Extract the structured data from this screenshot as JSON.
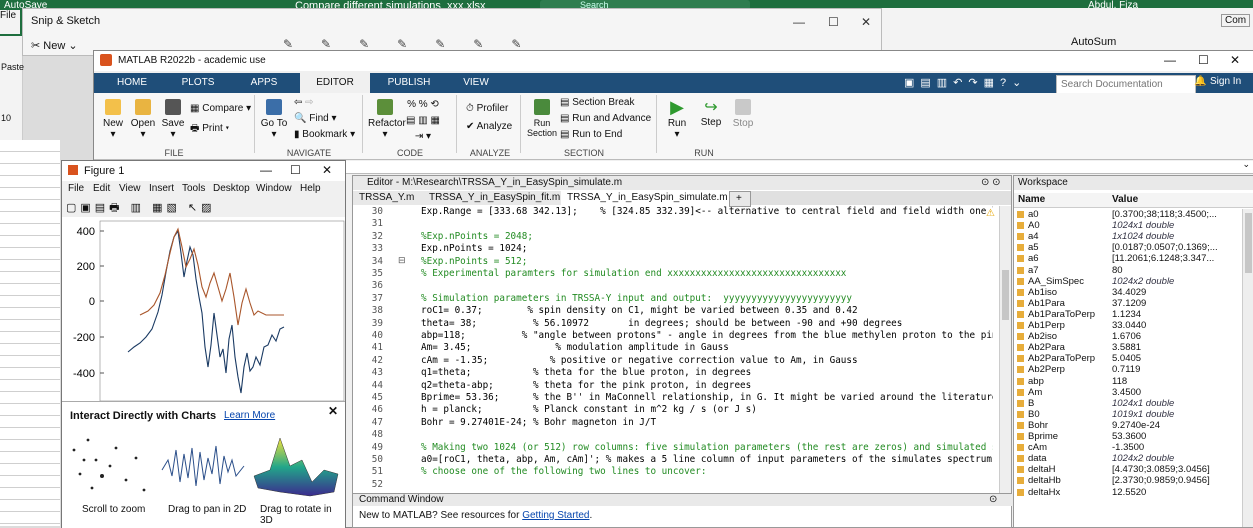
{
  "excel": {
    "title": "Compare different simulations_xxx.xlsx",
    "autosave_label": "AutoSave",
    "file_label": "File",
    "search_label": "Search",
    "user": "Abdul, Fiza",
    "autosum_label": "AutoSum",
    "paste_label": "Paste",
    "cell_ref": "10"
  },
  "snip": {
    "title": "Snip & Sketch",
    "new_label": "New"
  },
  "matlab": {
    "title": "MATLAB R2022b - academic use",
    "tabs": [
      "HOME",
      "PLOTS",
      "APPS",
      "EDITOR",
      "PUBLISH",
      "VIEW"
    ],
    "search_placeholder": "Search Documentation",
    "sign_in": "Sign In",
    "ribbon": {
      "new": "New",
      "open": "Open",
      "save": "Save",
      "compare": "Compare",
      "print": "Print",
      "goto": "Go To",
      "find": "Find",
      "bookmark": "Bookmark",
      "refactor": "Refactor",
      "profiler": "Profiler",
      "analyze": "Analyze",
      "run_section": "Run Section",
      "section_break": "Section Break",
      "run_and_advance": "Run and Advance",
      "run_to_end": "Run to End",
      "run": "Run",
      "step": "Step",
      "stop": "Stop",
      "sections": [
        "FILE",
        "NAVIGATE",
        "CODE",
        "ANALYZE",
        "SECTION",
        "RUN"
      ]
    }
  },
  "figure": {
    "title": "Figure 1",
    "menu": [
      "File",
      "Edit",
      "View",
      "Insert",
      "Tools",
      "Desktop",
      "Window",
      "Help"
    ],
    "y_ticks": [
      "400",
      "200",
      "0",
      "-200",
      "-400"
    ],
    "interact_title": "Interact Directly with Charts",
    "learn_more": "Learn More",
    "captions": [
      "Scroll to zoom",
      "Drag to pan in 2D",
      "Drag to rotate in 3D"
    ]
  },
  "editor": {
    "path": "Editor - M:\\Research\\TRSSA_Y_in_EasySpin_simulate.m",
    "tabs": [
      "TRSSA_Y.m",
      "TRSSA_Y_in_EasySpin_fit.m",
      "TRSSA_Y_in_EasySpin_simulate.m",
      "+"
    ],
    "lines": [
      {
        "n": "30",
        "t": "Exp.Range = [333.68 342.13];    % [324.85 332.39]<-- alternative to central field and field width one line"
      },
      {
        "n": "31",
        "t": ""
      },
      {
        "n": "32",
        "t": "%Exp.nPoints = 2048;"
      },
      {
        "n": "33",
        "t": "Exp.nPoints = 1024;"
      },
      {
        "n": "34",
        "t": "%Exp.nPoints = 512;"
      },
      {
        "n": "35",
        "t": "% Experimental paramters for simulation end xxxxxxxxxxxxxxxxxxxxxxxxxxxxxxxx"
      },
      {
        "n": "36",
        "t": ""
      },
      {
        "n": "37",
        "t": "% Simulation parameters in TRSSA-Y input and output:  yyyyyyyyyyyyyyyyyyyyyyy"
      },
      {
        "n": "38",
        "t": "roC1= 0.37;        % spin density on C1, might be varied between 0.35 and 0.42"
      },
      {
        "n": "39",
        "t": "theta= 38;          % 56.10972       in degrees; should be between -90 and +90 degrees"
      },
      {
        "n": "40",
        "t": "abp=118;          % \"angle between protons\" - angle in degrees from the blue methylen proton to the pink"
      },
      {
        "n": "41",
        "t": "Am= 3.45;               % modulation amplitude in Gauss"
      },
      {
        "n": "42",
        "t": "cAm = -1.35;           % positive or negative correction value to Am, in Gauss"
      },
      {
        "n": "43",
        "t": "q1=theta;           % theta for the blue proton, in degrees"
      },
      {
        "n": "44",
        "t": "q2=theta-abp;       % theta for the pink proton, in degrees"
      },
      {
        "n": "45",
        "t": "Bprime= 53.36;      % the B'' in MaConnell relationship, in G. It might be varied around the literature va"
      },
      {
        "n": "46",
        "t": "h = planck;         % Planck constant in m^2 kg / s (or J s)"
      },
      {
        "n": "47",
        "t": "Bohr = 9.27401E-24; % Bohr magneton in J/T"
      },
      {
        "n": "48",
        "t": ""
      },
      {
        "n": "49",
        "t": "% Making two 1024 (or 512) row columns: five simulation parameters (the rest are zeros) and simulated spec"
      },
      {
        "n": "50",
        "t": "a0=[roC1, theta, abp, Am, cAm]'; % makes a 5 line column of input parameters of the simulates spectrum"
      },
      {
        "n": "51",
        "t": "% choose one of the following two lines to uncover:"
      },
      {
        "n": "52",
        "t": ""
      }
    ]
  },
  "command_window": {
    "title": "Command Window",
    "message": "New to MATLAB? See resources for ",
    "link": "Getting Started",
    "suffix": "."
  },
  "workspace": {
    "title": "Workspace",
    "col_name": "Name",
    "col_value": "Value",
    "rows": [
      {
        "name": "a0",
        "value": "[0.3700;38;118;3.4500;..."
      },
      {
        "name": "A0",
        "value": "1024x1 double",
        "italic": true
      },
      {
        "name": "a4",
        "value": "1x1024 double",
        "italic": true
      },
      {
        "name": "a5",
        "value": "[0.0187;0.0507;0.1369;..."
      },
      {
        "name": "a6",
        "value": "[11.2061;6.1248;3.347..."
      },
      {
        "name": "a7",
        "value": "80"
      },
      {
        "name": "AA_SimSpec",
        "value": "1024x2 double",
        "italic": true
      },
      {
        "name": "Ab1iso",
        "value": "34.4029"
      },
      {
        "name": "Ab1Para",
        "value": "37.1209"
      },
      {
        "name": "Ab1ParaToPerp",
        "value": "1.1234"
      },
      {
        "name": "Ab1Perp",
        "value": "33.0440"
      },
      {
        "name": "Ab2iso",
        "value": "1.6706"
      },
      {
        "name": "Ab2Para",
        "value": "3.5881"
      },
      {
        "name": "Ab2ParaToPerp",
        "value": "5.0405"
      },
      {
        "name": "Ab2Perp",
        "value": "0.7119"
      },
      {
        "name": "abp",
        "value": "118"
      },
      {
        "name": "Am",
        "value": "3.4500"
      },
      {
        "name": "B",
        "value": "1024x1 double",
        "italic": true
      },
      {
        "name": "B0",
        "value": "1019x1 double",
        "italic": true
      },
      {
        "name": "Bohr",
        "value": "9.2740e-24"
      },
      {
        "name": "Bprime",
        "value": "53.3600"
      },
      {
        "name": "cAm",
        "value": "-1.3500"
      },
      {
        "name": "data",
        "value": "1024x2 double",
        "italic": true
      },
      {
        "name": "deltaH",
        "value": "[4.4730;3.0859;3.0456]"
      },
      {
        "name": "deltaHb",
        "value": "[2.3730;0.9859;0.9456]"
      },
      {
        "name": "deltaHx",
        "value": "12.5520"
      }
    ]
  }
}
